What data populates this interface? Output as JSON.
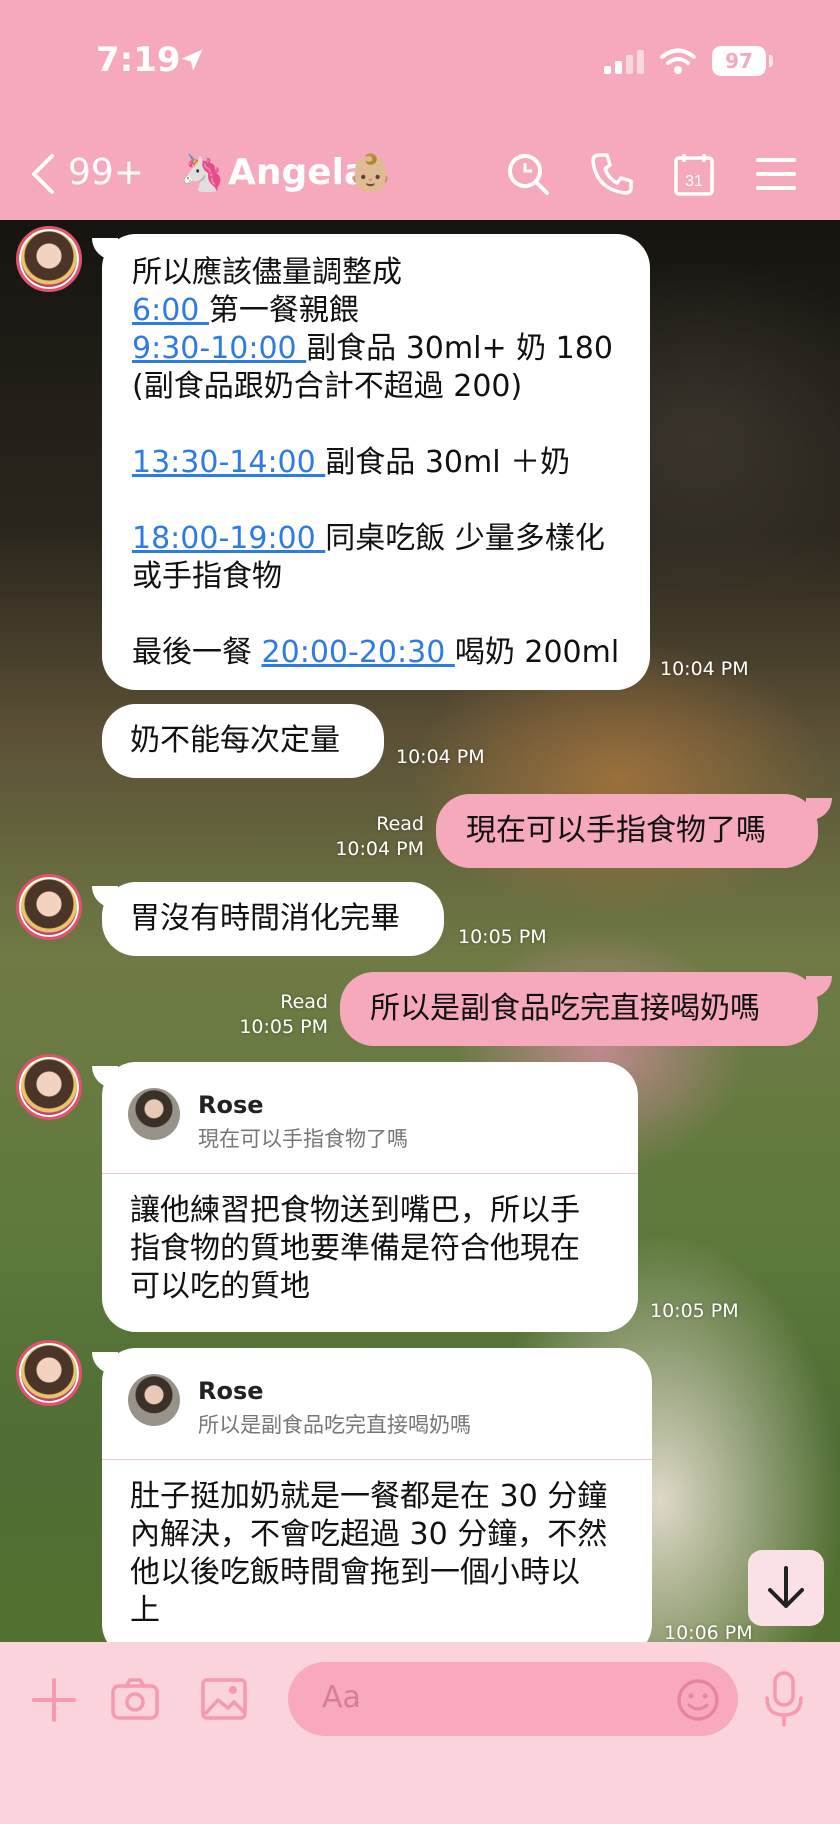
{
  "status": {
    "time": "7:19",
    "battery": "97"
  },
  "header": {
    "back_count": "99+",
    "title_prefix_emoji": "🦄",
    "title": "Angela",
    "title_suffix_emoji": "👶🏼"
  },
  "messages": {
    "m1": {
      "lines": [
        "所以應該儘量調整成",
        "",
        "",
        "(副食品跟奶合計不超過 200)",
        "",
        "",
        "",
        "",
        "或手指食物",
        "",
        ""
      ],
      "l2_link": "6:00 ",
      "l2_text": "第一餐親餵",
      "l3_link": "9:30-10:00 ",
      "l3_text": "副食品 30ml+ 奶 180",
      "l6_link": "13:30-14:00 ",
      "l6_text": "副食品 30ml ＋奶",
      "l8_link": "18:00-19:00 ",
      "l8_text": "同桌吃飯 少量多樣化",
      "l11_pre": "最後一餐 ",
      "l11_link": "20:00-20:30 ",
      "l11_text": "喝奶 200ml",
      "time": "10:04 PM"
    },
    "m2": {
      "text": "奶不能每次定量",
      "time": "10:04 PM"
    },
    "m3": {
      "text": "現在可以手指食物了嗎",
      "read": "Read",
      "time": "10:04 PM"
    },
    "m4": {
      "text": "胃沒有時間消化完畢",
      "time": "10:05 PM"
    },
    "m5": {
      "text": "所以是副食品吃完直接喝奶嗎",
      "read": "Read",
      "time": "10:05 PM"
    },
    "m6": {
      "reply_name": "Rose",
      "reply_quote": "現在可以手指食物了嗎",
      "lines": [
        "讓他練習把食物送到嘴巴，所以手",
        "指食物的質地要準備是符合他現在",
        "可以吃的質地"
      ],
      "time": "10:05 PM"
    },
    "m7": {
      "reply_name": "Rose",
      "reply_quote": "所以是副食品吃完直接喝奶嗎",
      "lines": [
        "肚子挺加奶就是一餐都是在 30 分鐘",
        "內解決，不會吃超過 30 分鐘，不然",
        "他以後吃飯時間會拖到一個小時以",
        "上"
      ],
      "time": "10:06 PM"
    }
  },
  "input": {
    "placeholder": "Aa"
  },
  "icons": {
    "location": "location-arrow-icon",
    "signal": "signal-icon",
    "wifi": "wifi-icon",
    "back": "chevron-left-icon",
    "search": "search-icon",
    "call": "phone-icon",
    "calendar": "calendar-icon",
    "menu": "menu-icon",
    "scroll_down": "arrow-down-icon",
    "plus": "plus-icon",
    "camera": "camera-icon",
    "image": "image-icon",
    "emoji": "smiley-icon",
    "mic": "microphone-icon"
  },
  "colors": {
    "theme_pink": "#f6a9bd",
    "link_blue": "#2f7be6",
    "input_bar": "#fbd3dc"
  }
}
